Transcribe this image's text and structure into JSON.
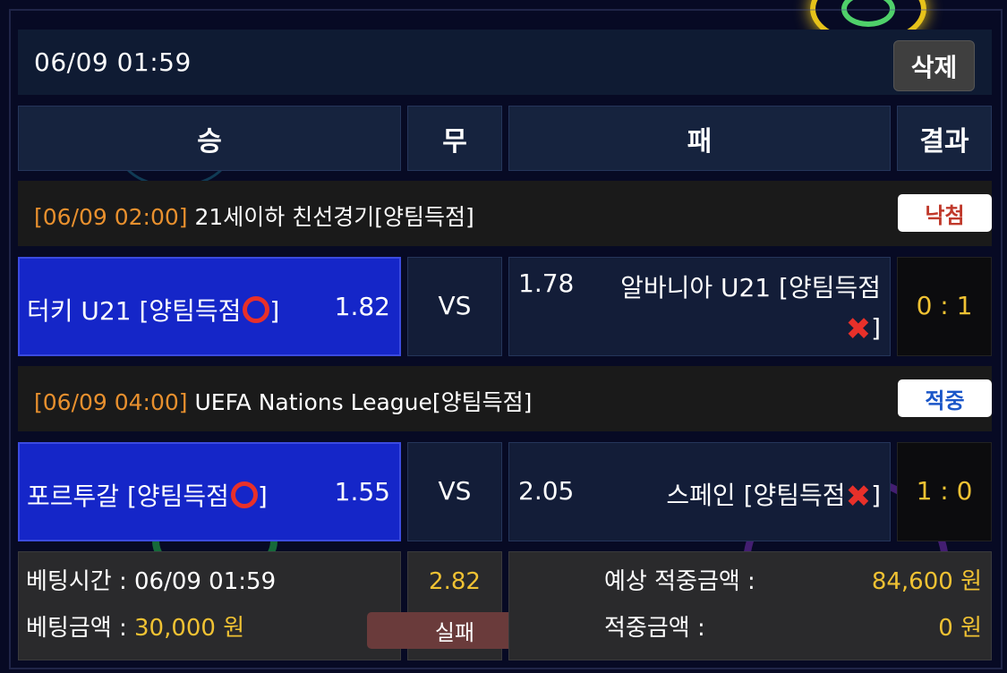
{
  "header": {
    "timestamp": "06/09 01:59",
    "delete_label": "삭제"
  },
  "columns": {
    "win": "승",
    "draw": "무",
    "lose": "패",
    "result": "결과"
  },
  "matches": [
    {
      "time": "[06/09 02:00]",
      "league": " 21세이하 친선경기[양팀득점]",
      "status": "낙첨",
      "status_color": "#c0392b",
      "home_team": "터키 U21 [양팀득점",
      "home_mark": "O",
      "home_close": "]",
      "home_odds": "1.82",
      "vs": "VS",
      "away_odds": "1.78",
      "away_team_line1": "알바니아 U21 [양팀득점",
      "away_mark": "X",
      "away_close": "]",
      "score": "0 : 1"
    },
    {
      "time": "[06/09 04:00]",
      "league": " UEFA Nations League[양팀득점]",
      "status": "적중",
      "status_color": "#1a56c8",
      "home_team": "포르투갈 [양팀득점",
      "home_mark": "O",
      "home_close": "]",
      "home_odds": "1.55",
      "vs": "VS",
      "away_odds": "2.05",
      "away_team": "스페인 [양팀득점",
      "away_mark": "X",
      "away_close": "]",
      "score": "1 : 0"
    }
  ],
  "footer": {
    "bet_time_label": "베팅시간 : ",
    "bet_time": "06/09 01:59",
    "bet_amount_label": "베팅금액 : ",
    "bet_amount": "30,000 원",
    "total_odds": "2.82",
    "fail_label": "실패",
    "expected_label": "예상 적중금액 :",
    "expected_amount": "84,600 원",
    "win_label": "적중금액 :",
    "win_amount": "0 원"
  },
  "colors": {
    "win_cell": "#1526c8",
    "accent_yellow": "#f0c233",
    "time_orange": "#e8902e"
  }
}
